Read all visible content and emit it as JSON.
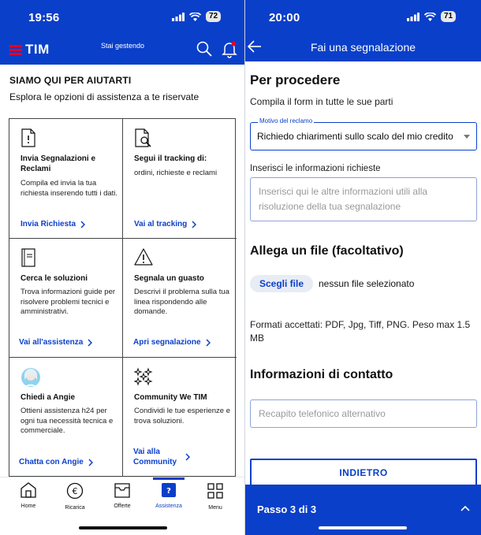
{
  "left": {
    "status": {
      "time": "19:56",
      "battery": "72"
    },
    "header": {
      "brand": "TIM",
      "gestendo": "Stai gestendo"
    },
    "intro": {
      "title": "SIAMO QUI PER AIUTARTI",
      "subtitle": "Esplora le opzioni di assistenza a te riservate"
    },
    "cards": [
      {
        "title": "Invia Segnalazioni e Reclami",
        "desc": "Compila ed invia la tua richiesta inserendo tutti i dati.",
        "link": "Invia Richiesta",
        "icon": "document-alert-icon"
      },
      {
        "title": "Segui il tracking di:",
        "desc": "ordini, richieste e reclami",
        "link": "Vai al tracking",
        "icon": "document-search-icon"
      },
      {
        "title": "Cerca le soluzioni",
        "desc": "Trova informazioni guide per risolvere problemi tecnici e amministrativi.",
        "link": "Vai all'assistenza",
        "icon": "book-icon"
      },
      {
        "title": "Segnala un guasto",
        "desc": "Descrivi il problema sulla tua linea rispondendo alle domande.",
        "link": "Apri segnalazione",
        "icon": "warning-triangle-icon"
      },
      {
        "title": "Chiedi a Angie",
        "desc": "Ottieni assistenza h24 per ogni tua necessità tecnica e commerciale.",
        "link": "Chatta con Angie",
        "icon": "angie-avatar-icon"
      },
      {
        "title": "Community We TIM",
        "desc": "Condividi le tue esperienze e trova soluzioni.",
        "link": "Vai alla Community",
        "icon": "community-icon"
      }
    ],
    "nav": [
      {
        "label": "Home",
        "icon": "home-icon"
      },
      {
        "label": "Ricarica",
        "icon": "euro-icon"
      },
      {
        "label": "Offerte",
        "icon": "offers-icon"
      },
      {
        "label": "Assistenza",
        "icon": "help-icon",
        "active": true
      },
      {
        "label": "Menu",
        "icon": "grid-icon"
      }
    ]
  },
  "right": {
    "status": {
      "time": "20:00",
      "battery": "71"
    },
    "header": {
      "title": "Fai una segnalazione"
    },
    "form": {
      "heading": "Per procedere",
      "subheading": "Compila il form in tutte le sue parti",
      "select_label": "Motivo del reclamo",
      "select_value": "Richiedo chiarimenti sullo scalo del mio credito",
      "info_label": "Inserisci le informazioni richieste",
      "info_placeholder": "Inserisci qui le altre informazioni utili alla risoluzione della tua segnalazione",
      "attach_heading": "Allega un file (facoltativo)",
      "file_button": "Scegli file",
      "file_status": "nessun file selezionato",
      "formats": "Formati accettati: PDF, Jpg, Tiff, PNG. Peso max 1.5 MB",
      "contact_heading": "Informazioni di contatto",
      "phone_placeholder": "Recapito telefonico alternativo",
      "back_button": "INDIETRO",
      "step": "Passo 3 di 3"
    }
  },
  "colors": {
    "brand_blue": "#0a3fc9",
    "tim_red": "#e4002b"
  }
}
